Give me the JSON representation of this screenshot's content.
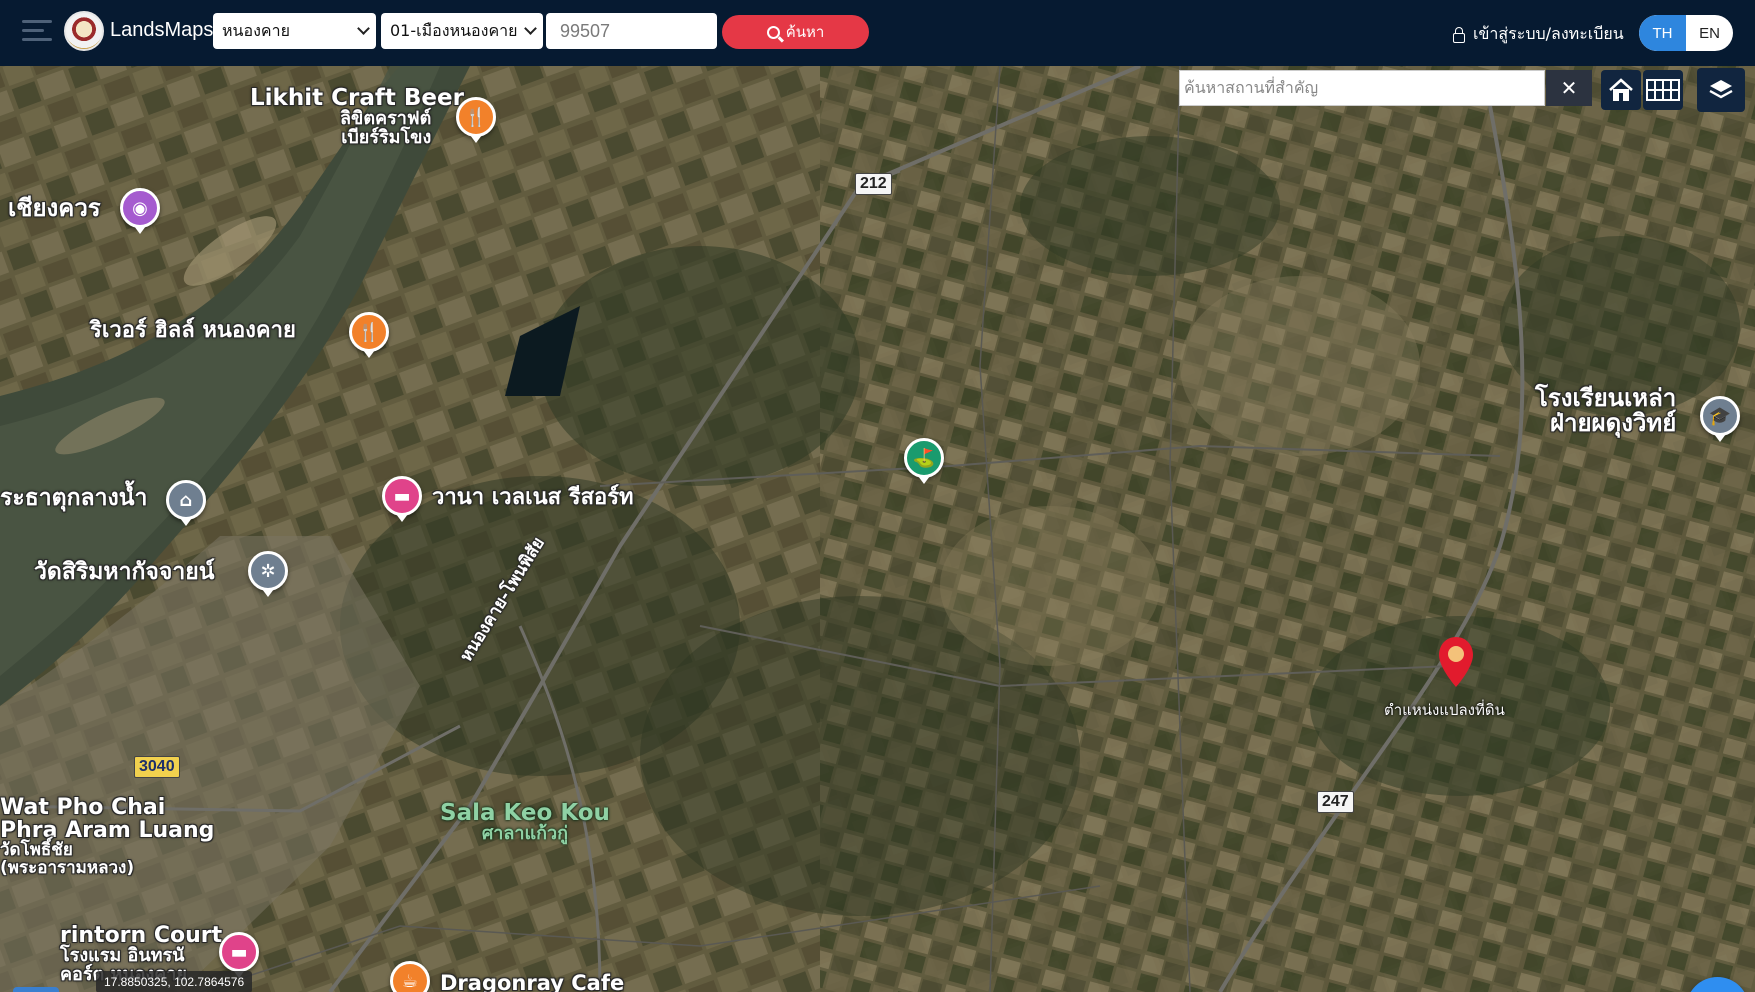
{
  "app": {
    "brand": "LandsMaps"
  },
  "search": {
    "province": "หนองคาย",
    "district": "01-เมืองหนองคาย",
    "parcel_number": "99507",
    "button_label": "ค้นหา"
  },
  "header": {
    "login_label": "เข้าสู่ระบบ/ลงทะเบียน",
    "lang_active": "TH",
    "lang_other": "EN"
  },
  "map_controls": {
    "place_search_placeholder": "ค้นหาสถานที่สำคัญ",
    "clear_label": "✕"
  },
  "map_labels": {
    "likhit_en": "Likhit Craft Beer",
    "likhit_th1": "ลิขิตคราฟต์",
    "likhit_th2": "เบียร์ริมโขง",
    "chiangkhuan": "เชียงควร",
    "river_hill": "ริเวอร์ ฮิลล์ หนองคาย",
    "phra_that": "ระธาตุกลางน้ำ",
    "wat_sirim": "วัดสิริมหากัจจายน์",
    "wana": "วานา เวลเนส รีสอร์ท",
    "road_name": "หนองคาย-โพนพิสัย",
    "school_1": "โรงเรียนเหล่า",
    "school_2": "ฝ่ายผดุงวิทย์",
    "wat_pho_1": "Wat Pho Chai",
    "wat_pho_2": "Phra Aram Luang",
    "wat_pho_3": "วัดโพธิ์ชัย",
    "wat_pho_4": "(พระอารามหลวง)",
    "sala_en": "Sala Keo Kou",
    "sala_th": "ศาลาแก้วกู่",
    "intorn_1": "rintorn Court",
    "intorn_2": "โรงแรม อินทรนั",
    "intorn_3": "คอร์ต หนองคาย",
    "dragonray": "Dragonray Cafe",
    "parcel_label": "ตำแหน่งแปลงที่ดิน"
  },
  "road_shields": {
    "r212": "212",
    "r3040": "3040",
    "r247": "247"
  },
  "coordinates": "17.8850325, 102.7864576",
  "icons": {
    "menu": "hamburger-icon",
    "search": "search-icon",
    "lock": "lock-icon",
    "home": "home-icon",
    "grid": "grid-icon",
    "layers": "layers-icon",
    "tools": "tools-icon",
    "more": "more-icon"
  },
  "colors": {
    "navbar": "#061a31",
    "search_button": "#e53846",
    "lang_active": "#2e86de",
    "marker": "#e21b2d",
    "fab": "#2f8ef0"
  }
}
